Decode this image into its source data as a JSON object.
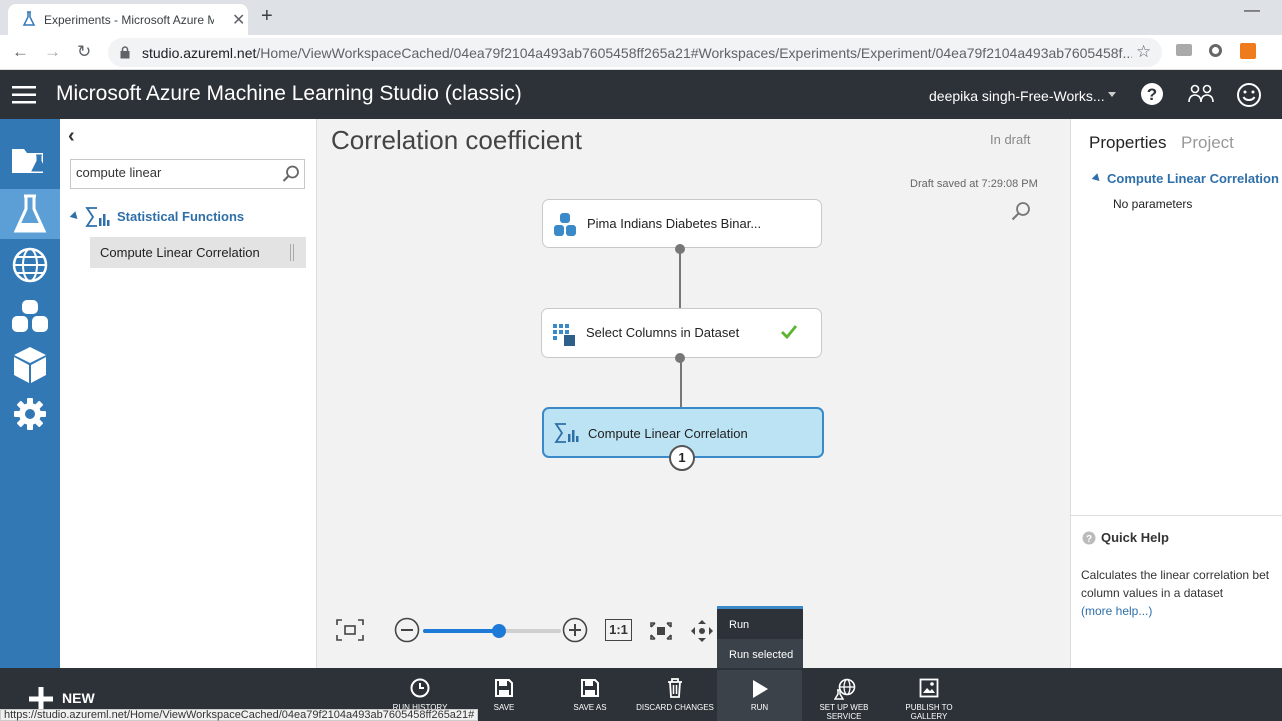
{
  "browser": {
    "tab_title": "Experiments - Microsoft Azure M",
    "url_host": "studio.azureml.net",
    "url_path": "/Home/ViewWorkspaceCached/04ea79f2104a493ab7605458ff265a21#Workspaces/Experiments/Experiment/04ea79f2104a493ab7605458f...",
    "status_url": "https://studio.azureml.net/Home/ViewWorkspaceCached/04ea79f2104a493ab7605458ff265a21#"
  },
  "header": {
    "title": "Microsoft Azure Machine Learning Studio (classic)",
    "user": "deepika singh-Free-Works..."
  },
  "palette": {
    "search_value": "compute linear",
    "category": "Statistical Functions",
    "module": "Compute Linear Correlation"
  },
  "canvas": {
    "title": "Correlation coefficient",
    "status": "In draft",
    "saved": "Draft saved at 7:29:08 PM",
    "nodes": [
      {
        "label": "Pima Indians Diabetes Binar..."
      },
      {
        "label": "Select Columns in Dataset"
      },
      {
        "label": "Compute Linear Correlation"
      }
    ],
    "port_badge": "1",
    "zoom_actual": "1:1",
    "zoom_level": 0.55
  },
  "run_menu": {
    "run": "Run",
    "run_selected": "Run selected"
  },
  "properties": {
    "tab_properties": "Properties",
    "tab_project": "Project",
    "section": "Compute Linear Correlation",
    "no_params": "No parameters",
    "quick_help_title": "Quick Help",
    "quick_help_line1": "Calculates the linear correlation bet",
    "quick_help_line2": "column values in a dataset",
    "more_help": "(more help...)"
  },
  "toolbar": {
    "new": "NEW",
    "run_history": "RUN HISTORY",
    "save": "SAVE",
    "save_as": "SAVE AS",
    "discard": "DISCARD CHANGES",
    "run": "RUN",
    "setup_web_1": "SET UP WEB",
    "setup_web_2": "SERVICE",
    "publish_1": "PUBLISH TO",
    "publish_2": "GALLERY"
  }
}
